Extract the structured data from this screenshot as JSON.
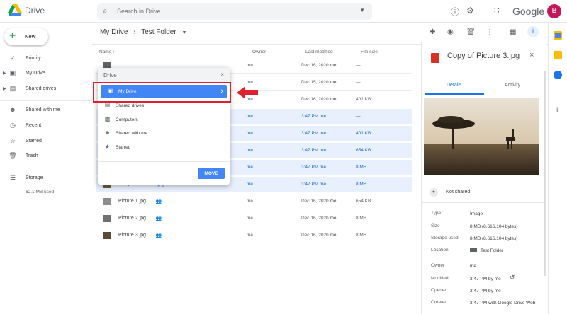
{
  "app": {
    "name": "Drive",
    "brand_word": "Google",
    "avatar_initial": "B",
    "avatar_color": "#c2185b"
  },
  "search": {
    "placeholder": "Search in Drive",
    "icon": "search-icon"
  },
  "topbar_icons": [
    "help-icon",
    "settings-icon",
    "apps-grid-icon"
  ],
  "sidebar": {
    "new_label": "New",
    "items": [
      {
        "label": "Priority",
        "icon": "priority-check-icon"
      },
      {
        "label": "My Drive",
        "icon": "my-drive-icon"
      },
      {
        "label": "Shared drives",
        "icon": "shared-drives-icon"
      },
      {
        "label": "Shared with me",
        "icon": "people-icon"
      },
      {
        "label": "Recent",
        "icon": "clock-icon"
      },
      {
        "label": "Starred",
        "icon": "star-icon"
      },
      {
        "label": "Trash",
        "icon": "trash-icon"
      },
      {
        "label": "Storage",
        "icon": "storage-icon"
      }
    ],
    "storage_used": "62.1 MB used"
  },
  "breadcrumb": {
    "root": "My Drive",
    "sep": "›",
    "current": "Test Folder"
  },
  "columns": {
    "name": "Name",
    "owner": "Owner",
    "modified": "Last modified",
    "size": "File size"
  },
  "rows": [
    {
      "name": "",
      "owner": "me",
      "date": "Dec 16, 2020",
      "by": "me",
      "size": "—",
      "selected": false
    },
    {
      "name": "",
      "owner": "me",
      "date": "Dec 15, 2020",
      "by": "me",
      "size": "—",
      "selected": false
    },
    {
      "name": "",
      "owner": "me",
      "date": "Dec 16, 2020",
      "by": "me",
      "size": "401 KB",
      "selected": false
    },
    {
      "name": "",
      "owner": "me",
      "date": "3:47 PM",
      "by": "me",
      "size": "—",
      "selected": true
    },
    {
      "name": "",
      "owner": "me",
      "date": "3:47 PM",
      "by": "me",
      "size": "401 KB",
      "selected": true
    },
    {
      "name": "",
      "owner": "me",
      "date": "3:47 PM",
      "by": "me",
      "size": "654 KB",
      "selected": true
    },
    {
      "name": "",
      "owner": "me",
      "date": "3:47 PM",
      "by": "me",
      "size": "8 MB",
      "selected": true
    },
    {
      "name": "Copy of Picture 3.jpg",
      "owner": "me",
      "date": "3:47 PM",
      "by": "me",
      "size": "8 MB",
      "selected": true
    },
    {
      "name": "Picture 1.jpg",
      "owner": "me",
      "date": "Dec 16, 2020",
      "by": "me",
      "size": "654 KB",
      "selected": false
    },
    {
      "name": "Picture 2.jpg",
      "owner": "me",
      "date": "Dec 16, 2020",
      "by": "me",
      "size": "8 MB",
      "selected": false
    },
    {
      "name": "Picture 3.jpg",
      "owner": "me",
      "date": "Dec 16, 2020",
      "by": "me",
      "size": "8 MB",
      "selected": false
    }
  ],
  "move_dialog": {
    "title": "Drive",
    "close": "×",
    "items": [
      "My Drive",
      "Shared drives",
      "Computers",
      "Shared with me",
      "Starred"
    ],
    "move_label": "MOVE",
    "highlight_color": "#e0202c"
  },
  "details": {
    "title": "Copy of Picture 3.jpg",
    "close": "×",
    "tabs": [
      "Details",
      "Activity"
    ],
    "sharing": "Not shared",
    "props": [
      {
        "k": "Type",
        "v": "Image"
      },
      {
        "k": "Size",
        "v": "8 MB (8,616,104 bytes)"
      },
      {
        "k": "Storage used",
        "v": "8 MB (8,616,104 bytes)"
      },
      {
        "k": "Location",
        "v": "Test Folder"
      },
      {
        "k": "Owner",
        "v": "me"
      },
      {
        "k": "Modified",
        "v": "3:47 PM by me"
      },
      {
        "k": "Opened",
        "v": "3:47 PM by me"
      },
      {
        "k": "Created",
        "v": "3:47 PM with Google Drive Web"
      }
    ]
  },
  "colors": {
    "accent": "#1a73e8",
    "selected_row": "#e8f0fe",
    "move_button": "#4285f4"
  }
}
